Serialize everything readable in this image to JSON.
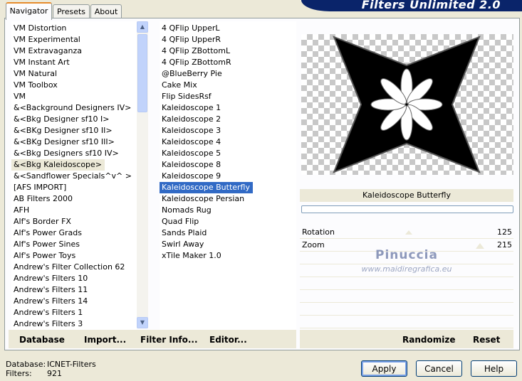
{
  "header": {
    "title": "Filters Unlimited 2.0"
  },
  "tabs": [
    {
      "label": "Navigator"
    },
    {
      "label": "Presets"
    },
    {
      "label": "About"
    }
  ],
  "categories": {
    "items": [
      "VM Distortion",
      "VM Experimental",
      "VM Extravaganza",
      "VM Instant Art",
      "VM Natural",
      "VM Toolbox",
      "VM",
      "&<Background Designers IV>",
      "&<Bkg Designer sf10 I>",
      "&<BKg Designer sf10 II>",
      "&<BKg Designer sf10 III>",
      "&<Bkg Designers sf10 IV>",
      "&<Bkg Kaleidoscope>",
      "&<Sandflower Specials^v^ >",
      "[AFS IMPORT]",
      "AB Filters 2000",
      "AFH",
      "Alf's Border FX",
      "Alf's Power Grads",
      "Alf's Power Sines",
      "Alf's Power Toys",
      "Andrew's Filter Collection 62",
      "Andrew's Filters 10",
      "Andrew's Filters 11",
      "Andrew's Filters 14",
      "Andrew's Filters 1",
      "Andrew's Filters 3"
    ],
    "focused": "&<Bkg Kaleidoscope>"
  },
  "filters": {
    "items": [
      "4 QFlip UpperL",
      "4 QFlip UpperR",
      "4 QFlip ZBottomL",
      "4 QFlip ZBottomR",
      "@BlueBerry Pie",
      "Cake Mix",
      "Flip SidesRsf",
      "Kaleidoscope 1",
      "Kaleidoscope 2",
      "Kaleidoscope 3",
      "Kaleidoscope 4",
      "Kaleidoscope 5",
      "Kaleidoscope 8",
      "Kaleidoscope 9",
      "Kaleidoscope Butterfly",
      "Kaleidoscope Persian",
      "Nomads Rug",
      "Quad Flip",
      "Sands Plaid",
      "Swirl Away",
      "xTile Maker 1.0"
    ],
    "selected": "Kaleidoscope Butterfly"
  },
  "preview": {
    "filter_name": "Kaleidoscope Butterfly"
  },
  "params": [
    {
      "label": "Rotation",
      "value": "125"
    },
    {
      "label": "Zoom",
      "value": "215"
    }
  ],
  "watermark": {
    "line1": "Pinuccia",
    "line2": "www.maidiregrafica.eu"
  },
  "toolbar": {
    "database": "Database",
    "import": "Import...",
    "filter_info": "Filter Info...",
    "editor": "Editor...",
    "randomize": "Randomize",
    "reset": "Reset"
  },
  "status": {
    "database_label": "Database:",
    "database_value": "ICNET-Filters",
    "filters_label": "Filters:",
    "filters_value": "921"
  },
  "buttons": {
    "apply": "Apply",
    "cancel": "Cancel",
    "help": "Help"
  },
  "colors": {
    "selection": "#316ac5",
    "banner": "#0a246a",
    "face": "#ece9d8"
  }
}
